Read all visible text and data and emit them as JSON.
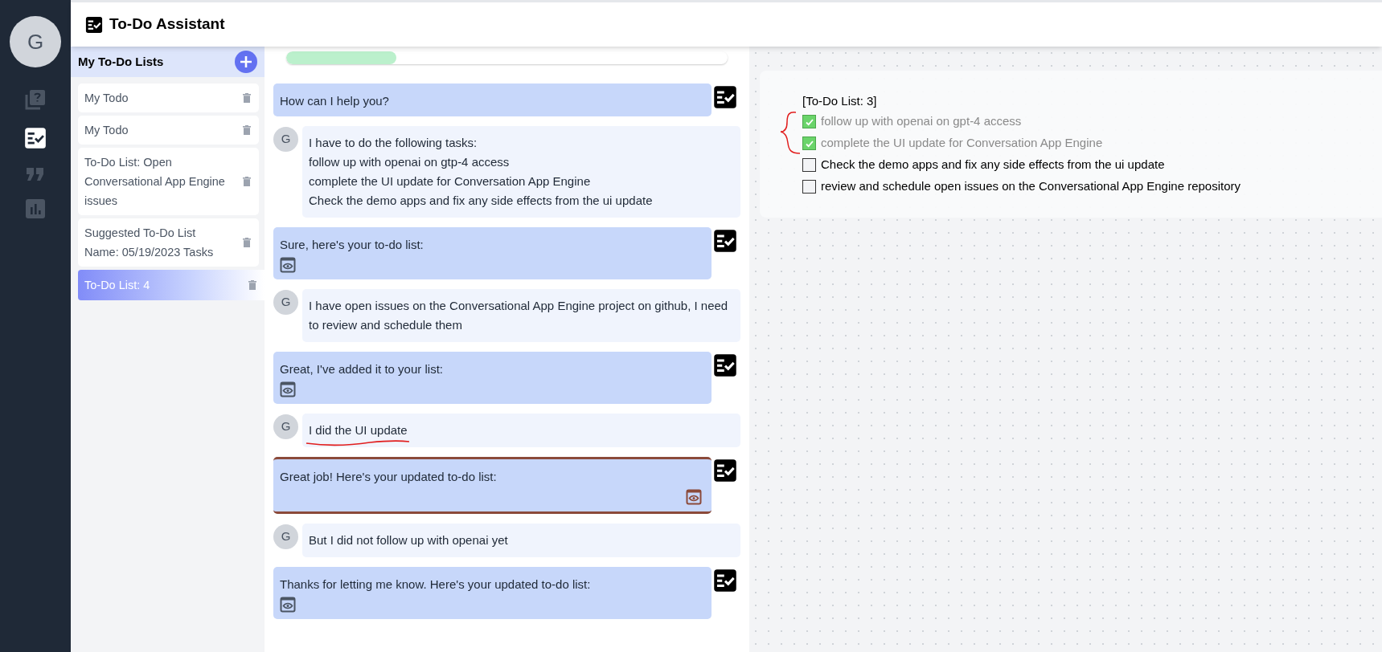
{
  "user_avatar": {
    "initial": "G"
  },
  "nav": [
    {
      "kind": "help",
      "selected": false
    },
    {
      "kind": "todo",
      "selected": true
    },
    {
      "kind": "quote",
      "selected": false
    },
    {
      "kind": "chart",
      "selected": false
    }
  ],
  "header": {
    "title": "To-Do Assistant"
  },
  "lists_panel": {
    "title": "My To-Do Lists",
    "items": [
      {
        "label": "My Todo",
        "selected": false
      },
      {
        "label": "My Todo",
        "selected": false
      },
      {
        "label": "To-Do List: Open Conversational App Engine issues",
        "selected": false
      },
      {
        "label": "Suggested To-Do List Name: 05/19/2023 Tasks",
        "selected": false
      },
      {
        "label": "To-Do List: 4",
        "selected": true
      }
    ]
  },
  "progress": {
    "level": 0.25
  },
  "messages": [
    {
      "kind": "assistant",
      "lines": [
        "How can I help you?"
      ],
      "list_link": false,
      "highlighted": false
    },
    {
      "kind": "user",
      "avatar": "G",
      "lines": [
        "I have to do the following tasks:",
        "follow up with openai on gtp-4 access",
        "complete the UI update for Conversation App Engine",
        "Check the demo apps and fix any side effects from the ui update"
      ],
      "underlined": false
    },
    {
      "kind": "assistant",
      "lines": [
        "Sure, here's your to-do list:"
      ],
      "list_link": true,
      "highlighted": false
    },
    {
      "kind": "user",
      "avatar": "G",
      "lines": [
        "I have open issues on the Conversational App Engine project on github, I need to review and schedule them"
      ],
      "underlined": false
    },
    {
      "kind": "assistant",
      "lines": [
        "Great, I've added it to your list:"
      ],
      "list_link": true,
      "highlighted": false
    },
    {
      "kind": "user",
      "avatar": "G",
      "lines": [
        "I did the UI update"
      ],
      "underlined": true
    },
    {
      "kind": "assistant",
      "lines": [
        "Great job! Here's your updated to-do list:"
      ],
      "list_link": true,
      "highlighted": true
    },
    {
      "kind": "user",
      "avatar": "G",
      "lines": [
        "But I did not follow up with openai yet"
      ],
      "underlined": false
    },
    {
      "kind": "assistant",
      "lines": [
        "Thanks for letting me know. Here's your updated to-do list:"
      ],
      "list_link": true,
      "highlighted": false
    }
  ],
  "todo_view": {
    "title": "[To-Do List: 3]",
    "bracketed_done": true,
    "items": [
      {
        "text": "follow up with openai on gpt-4 access",
        "checked": true
      },
      {
        "text": "complete the UI update for Conversation App Engine",
        "checked": true
      },
      {
        "text": "Check the demo apps and fix any side effects from the ui update",
        "checked": false
      },
      {
        "text": "review and schedule open issues on the Conversational App Engine repository",
        "checked": false
      }
    ]
  }
}
